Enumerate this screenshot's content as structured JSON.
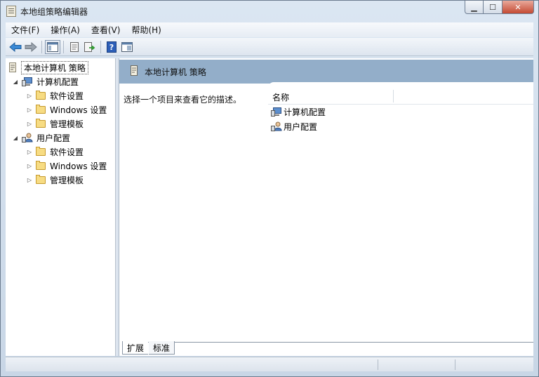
{
  "window": {
    "title": "本地组策略编辑器"
  },
  "menu": [
    "文件(F)",
    "操作(A)",
    "查看(V)",
    "帮助(H)"
  ],
  "tree": {
    "root": "本地计算机 策略",
    "computer": {
      "label": "计算机配置",
      "children": [
        "软件设置",
        "Windows 设置",
        "管理模板"
      ]
    },
    "user": {
      "label": "用户配置",
      "children": [
        "软件设置",
        "Windows 设置",
        "管理模板"
      ]
    }
  },
  "right": {
    "header": "本地计算机 策略",
    "description": "选择一个项目来查看它的描述。",
    "column_name": "名称",
    "items": [
      "计算机配置",
      "用户配置"
    ],
    "tabs": [
      "扩展",
      "标准"
    ]
  },
  "colors": {
    "header_bg": "#93aec9",
    "folder": "#f7dc83",
    "nav_arrow": "#3a8ad6"
  },
  "icons": [
    "back-arrow-icon",
    "forward-arrow-icon",
    "console-tree-icon",
    "properties-icon",
    "export-icon",
    "help-icon",
    "view-icon",
    "computer-icon",
    "user-icon",
    "folder-icon",
    "policy-doc-icon"
  ]
}
